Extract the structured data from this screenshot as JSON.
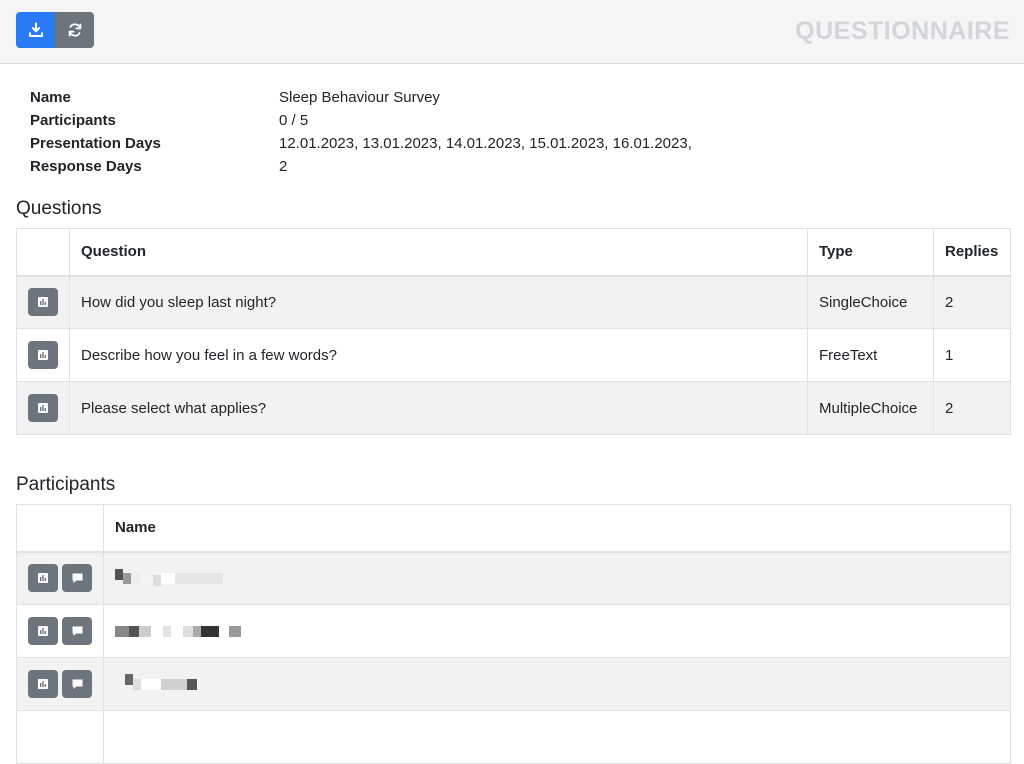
{
  "header": {
    "brand": "QUESTIONNAIRE",
    "download_icon": "download-icon",
    "refresh_icon": "refresh-icon"
  },
  "info": [
    {
      "label": "Name",
      "value": "Sleep Behaviour Survey"
    },
    {
      "label": "Participants",
      "value": "0 / 5"
    },
    {
      "label": "Presentation Days",
      "value": "12.01.2023, 13.01.2023, 14.01.2023, 15.01.2023, 16.01.2023,"
    },
    {
      "label": "Response Days",
      "value": "2"
    }
  ],
  "questions": {
    "title": "Questions",
    "columns": [
      "",
      "Question",
      "Type",
      "Replies"
    ],
    "rows": [
      {
        "question": "How did you sleep last night?",
        "type": "SingleChoice",
        "replies": "2"
      },
      {
        "question": "Describe how you feel in a few words?",
        "type": "FreeText",
        "replies": "1"
      },
      {
        "question": "Please select what applies?",
        "type": "MultipleChoice",
        "replies": "2"
      }
    ]
  },
  "participants": {
    "title": "Participants",
    "columns": [
      "",
      "Name"
    ]
  },
  "colors": {
    "primary": "#2b7af5",
    "secondary": "#6c757d",
    "stripe": "#f2f2f2"
  }
}
